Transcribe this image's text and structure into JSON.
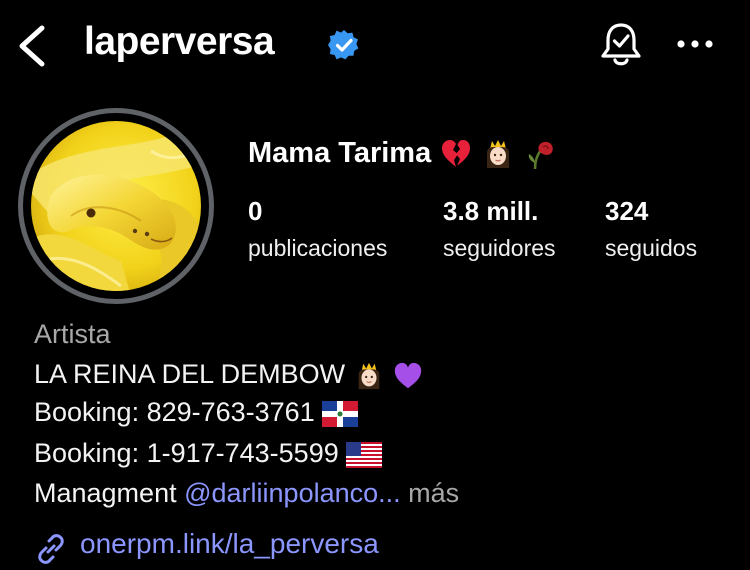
{
  "header": {
    "username": "laperversa",
    "icons": [
      "back-arrow-icon",
      "verified-badge-icon",
      "notification-bell-icon",
      "more-options-icon"
    ]
  },
  "profile": {
    "display_name": "Mama Tarima",
    "name_emojis": [
      "broken-heart",
      "princess",
      "wilted-rose"
    ],
    "stats": [
      {
        "value": "0",
        "label": "publicaciones"
      },
      {
        "value": "3.8 mill.",
        "label": "seguidores"
      },
      {
        "value": "324",
        "label": "seguidos"
      }
    ]
  },
  "bio": {
    "category": "Artista",
    "line1": "LA REINA DEL DEMBOW",
    "line2": "Booking: 829-763-3761",
    "line3": "Booking: 1-917-743-5599",
    "line4_prefix": "Managment",
    "line4_mention": "@darliinpolanco",
    "line4_ellipsis": "...",
    "more_label": "más",
    "link": "onerpm.link/la_perversa"
  },
  "colors": {
    "background": "#000000",
    "accent_link": "#8c96ff",
    "verified": "#3897f0",
    "muted": "#a8a8a8",
    "avatar_ring": "#5f6266"
  }
}
